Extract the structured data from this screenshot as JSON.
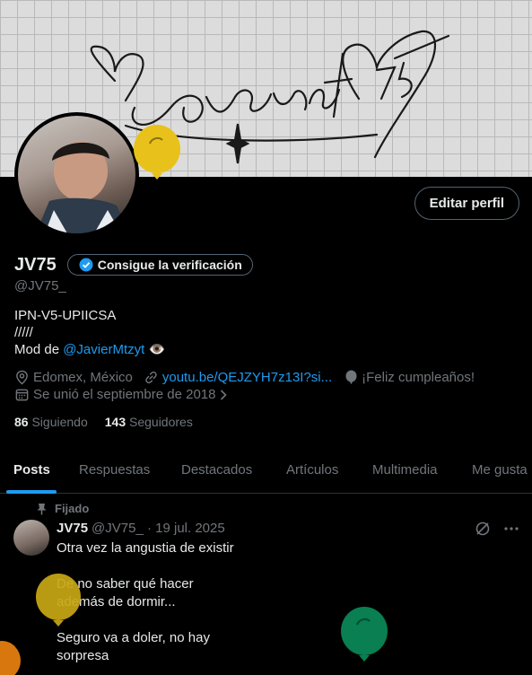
{
  "banner": {
    "signature_text": "Lovencito 75"
  },
  "header": {
    "edit_profile_label": "Editar perfil",
    "display_name": "JV75",
    "verify_label": "Consigue la verificación",
    "handle": "@JV75_"
  },
  "bio": {
    "line1": "IPN-V5-UPIICSA",
    "line2": "/////",
    "mod_prefix": "Mod de ",
    "mod_link": "@JavierMtzyt",
    "emoji": "👁️"
  },
  "meta": {
    "location": "Edomex, México",
    "website": "youtu.be/QEJZYH7z13I?si...",
    "birthday": "¡Feliz cumpleaños!",
    "joined": "Se unió el septiembre de 2018"
  },
  "stats": {
    "following_count": "86",
    "following_label": "Siguiendo",
    "followers_count": "143",
    "followers_label": "Seguidores"
  },
  "tabs": [
    {
      "label": "Posts"
    },
    {
      "label": "Respuestas"
    },
    {
      "label": "Destacados"
    },
    {
      "label": "Artículos"
    },
    {
      "label": "Multimedia"
    },
    {
      "label": "Me gusta"
    }
  ],
  "post": {
    "pinned_label": "Fijado",
    "author": "JV75",
    "handle_date": "@JV75_ · 19 jul. 2025",
    "lines": [
      "Otra vez la angustia de existir",
      "De no saber qué hacer además de dormir...",
      "Seguro va a doler, no hay sorpresa"
    ]
  },
  "colors": {
    "accent": "#1d9bf0",
    "muted": "#71767b",
    "balloon_yellow": "#e8c21a",
    "balloon_green": "#0a8a5a",
    "balloon_orange": "#d9770f"
  }
}
